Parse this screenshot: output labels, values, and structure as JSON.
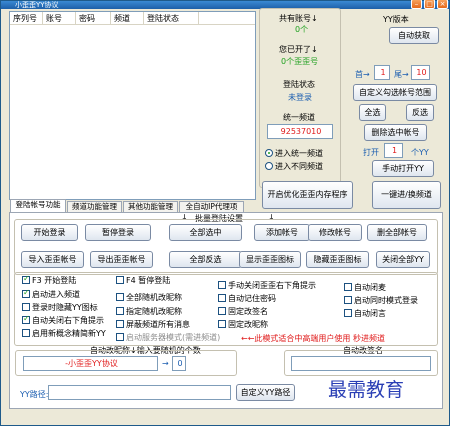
{
  "window": {
    "title": "小歪歪YY协议"
  },
  "list": {
    "columns": [
      "序列号",
      "账号",
      "密码",
      "频道",
      "登陆状态"
    ]
  },
  "stats": {
    "total_accounts_label": "共有账号↓",
    "total_accounts_value": "0个",
    "opened_label": "您已开了↓",
    "opened_value": "0个歪歪号",
    "login_status_label": "登陆状态",
    "login_status_value": "未登录",
    "channel_label": "统一频道",
    "channel_value": "92537010",
    "radio_unified": "进入统一频道",
    "radio_different": "进入不同频道"
  },
  "version": {
    "label": "YY版本",
    "auto_get_button": "自动获取"
  },
  "range": {
    "head_label": "首→",
    "head_value": "1",
    "tail_label": "尾→",
    "tail_value": "10",
    "custom_range_button": "自定义勾选帐号范围",
    "select_all_button": "全选",
    "invert_button": "反选",
    "delete_selected_button": "删除选中帐号",
    "open_label": "打开",
    "open_value": "1",
    "open_unit": "个YY",
    "manual_open_button": "手动打开YY"
  },
  "big_buttons": {
    "optimize_memory": "开启优化歪歪内存程序",
    "one_click_switch": "一键进/换频道"
  },
  "tabs": [
    {
      "label": "登陆帐号功能",
      "active": true
    },
    {
      "label": "频道功能管理",
      "active": false
    },
    {
      "label": "其他功能管理",
      "active": false
    },
    {
      "label": "全自动IP代理项",
      "active": false
    }
  ],
  "batch_label": "批量登陆设置",
  "panel_buttons": {
    "start_login": "开始登录",
    "pause_login": "暂停登录",
    "select_all": "全部选中",
    "add_account": "添加帐号",
    "modify_account": "修改帐号",
    "delete_all_accounts": "删全部帐号",
    "import_account": "导入歪歪帐号",
    "export_account": "导出歪歪帐号",
    "select_invert": "全部反选",
    "show_icons": "显示歪歪图标",
    "hide_icons": "隐藏歪歪图标",
    "close_all_yy": "关闭全部YY"
  },
  "options": {
    "col1": [
      {
        "label": "F3 开始登陆",
        "checked": true
      },
      {
        "label": "启动进入频道",
        "checked": true
      },
      {
        "label": "登录时隐藏YY图标",
        "checked": false
      },
      {
        "label": "自动关闭右下角提示",
        "checked": true
      },
      {
        "label": "启用新概念精简新YY",
        "checked": false
      }
    ],
    "col2": [
      {
        "label": "F4 暂停登陆",
        "checked": false
      },
      {
        "label": "全部随机改昵称",
        "checked": false
      },
      {
        "label": "指定随机改昵称",
        "checked": false
      },
      {
        "label": "屏蔽频道所有消息",
        "checked": false
      },
      {
        "label": "启动服务器模式(需进频道)",
        "checked": false
      }
    ],
    "col3": [
      {
        "label": "手动关闭歪歪右下角提示",
        "checked": false
      },
      {
        "label": "自动记住密码",
        "checked": false
      },
      {
        "label": "固定改签名",
        "checked": false
      },
      {
        "label": "固定改昵称",
        "checked": false
      }
    ],
    "col4": [
      {
        "label": "自动闭麦",
        "checked": false
      },
      {
        "label": "启动同时模式登录",
        "checked": false
      },
      {
        "label": "自动闭言",
        "checked": false
      }
    ]
  },
  "server_mode_note": "←←此模式适合中高端用户使用 秒进频道",
  "nickname": {
    "label": "自动改昵称↓输入要随机的个数",
    "value": "-小歪歪YY协议",
    "count": "0"
  },
  "signature": {
    "label": "自动改签名",
    "value": ""
  },
  "path": {
    "label": "YY路径:",
    "value": "",
    "custom_button": "自定义YY路径"
  },
  "watermark": "最需教育"
}
